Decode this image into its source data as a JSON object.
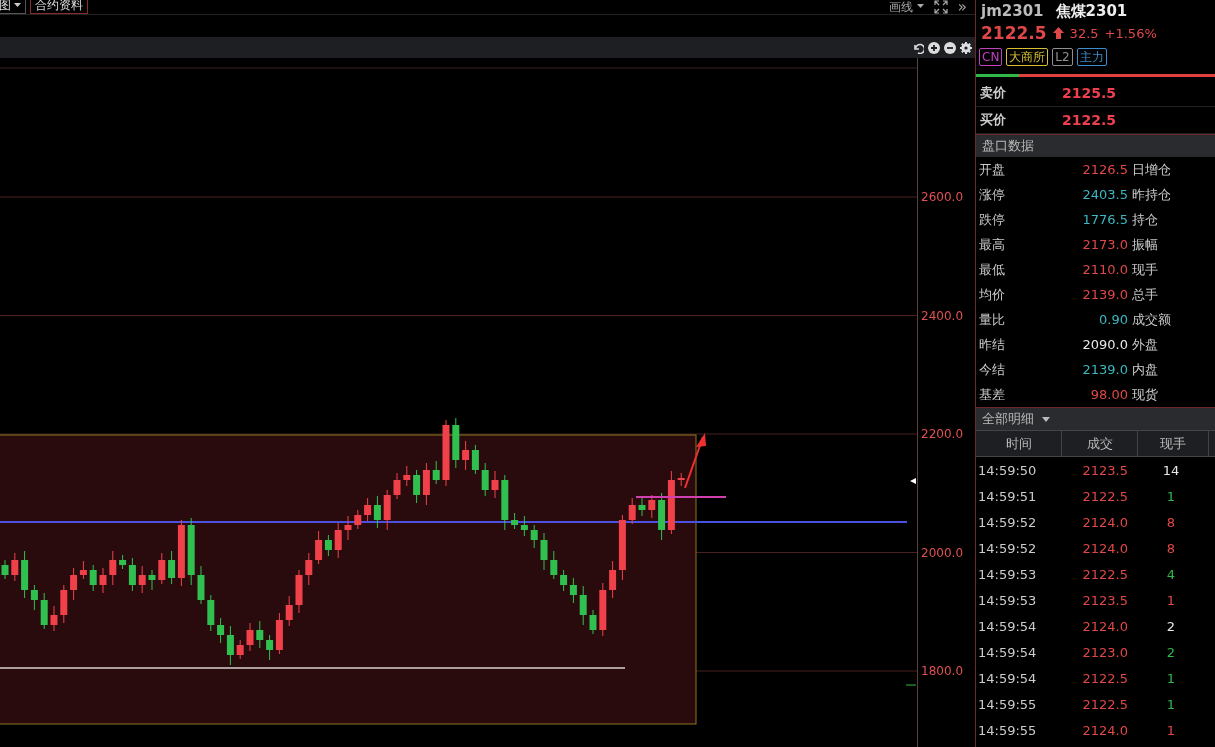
{
  "toolbar": {
    "left_buttons": [
      {
        "label": "图",
        "kind": "dropdown"
      },
      {
        "label": "合约资料",
        "kind": "button"
      }
    ],
    "draw_menu": "画线",
    "more": "»"
  },
  "chart": {
    "price_axis": [
      "2600.0",
      "2400.0",
      "2200.0",
      "2000.0",
      "1800.0"
    ]
  },
  "quote": {
    "code": "jm2301",
    "name": "焦煤2301",
    "price": "2122.5",
    "change": "32.5",
    "change_pct": "+1.56%",
    "tags": [
      {
        "label": "CN",
        "color": "#c040c0"
      },
      {
        "label": "大商所",
        "color": "#d8c030"
      },
      {
        "label": "L2",
        "color": "#909090"
      },
      {
        "label": "主力",
        "color": "#3a8ed0"
      }
    ],
    "buy_sell_bar": {
      "level": 0.18
    },
    "ask": {
      "label": "卖价",
      "value": "2125.5"
    },
    "bid": {
      "label": "买价",
      "value": "2122.5"
    }
  },
  "market_data": {
    "title": "盘口数据",
    "rows": [
      {
        "label": "开盘",
        "value": "2126.5",
        "color": "#e04848",
        "label_2": "日增仓"
      },
      {
        "label": "涨停",
        "value": "2403.5",
        "color": "#3ab8c0",
        "label_2": "昨持仓"
      },
      {
        "label": "跌停",
        "value": "1776.5",
        "color": "#3ab8c0",
        "label_2": "持仓"
      },
      {
        "label": "最高",
        "value": "2173.0",
        "color": "#e04848",
        "label_2": "振幅"
      },
      {
        "label": "最低",
        "value": "2110.0",
        "color": "#e04848",
        "label_2": "现手"
      },
      {
        "label": "均价",
        "value": "2139.0",
        "color": "#e04848",
        "label_2": "总手"
      },
      {
        "label": "量比",
        "value": "0.90",
        "color": "#3ab8c0",
        "label_2": "成交额"
      },
      {
        "label": "昨结",
        "value": "2090.0",
        "color": "#e8e8e8",
        "label_2": "外盘"
      },
      {
        "label": "今结",
        "value": "2139.0",
        "color": "#3ab8c0",
        "label_2": "内盘"
      },
      {
        "label": "基差",
        "value": "98.00",
        "color": "#e04848",
        "label_2": "现货"
      }
    ]
  },
  "trades": {
    "title": "全部明细",
    "columns": [
      "时间",
      "成交",
      "现手"
    ],
    "rows": [
      {
        "time": "14:59:50",
        "price": "2123.5",
        "volume": "14",
        "color": "#e8e8e8"
      },
      {
        "time": "14:59:51",
        "price": "2122.5",
        "volume": "1",
        "color": "#30b848"
      },
      {
        "time": "14:59:52",
        "price": "2124.0",
        "volume": "8",
        "color": "#e04848"
      },
      {
        "time": "14:59:52",
        "price": "2124.0",
        "volume": "8",
        "color": "#e04848"
      },
      {
        "time": "14:59:53",
        "price": "2122.5",
        "volume": "4",
        "color": "#30b848"
      },
      {
        "time": "14:59:53",
        "price": "2123.5",
        "volume": "1",
        "color": "#e04848"
      },
      {
        "time": "14:59:54",
        "price": "2124.0",
        "volume": "2",
        "color": "#e8e8e8"
      },
      {
        "time": "14:59:54",
        "price": "2123.0",
        "volume": "2",
        "color": "#30b848"
      },
      {
        "time": "14:59:54",
        "price": "2122.5",
        "volume": "1",
        "color": "#30b848"
      },
      {
        "time": "14:59:55",
        "price": "2122.5",
        "volume": "1",
        "color": "#30b848"
      },
      {
        "time": "14:59:55",
        "price": "2124.0",
        "volume": "1",
        "color": "#e04848"
      }
    ]
  }
}
